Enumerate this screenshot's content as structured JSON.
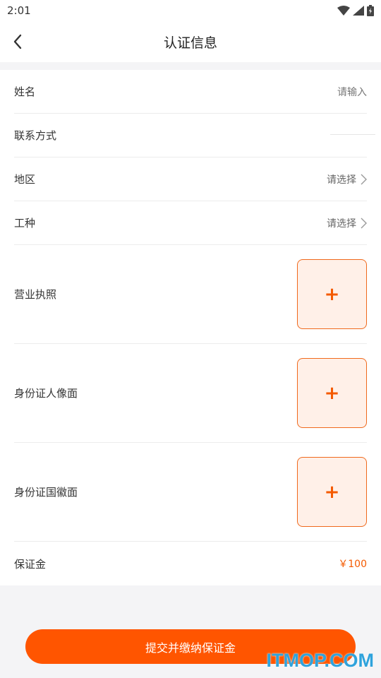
{
  "status_bar": {
    "time": "2:01"
  },
  "nav": {
    "title": "认证信息"
  },
  "form": {
    "name": {
      "label": "姓名",
      "placeholder": "请输入"
    },
    "contact": {
      "label": "联系方式"
    },
    "region": {
      "label": "地区",
      "value": "请选择"
    },
    "trade": {
      "label": "工种",
      "value": "请选择"
    },
    "license": {
      "label": "营业执照",
      "plus": "+"
    },
    "id_front": {
      "label": "身份证人像面",
      "plus": "+"
    },
    "id_back": {
      "label": "身份证国徽面",
      "plus": "+"
    },
    "deposit": {
      "label": "保证金",
      "value": "￥100"
    }
  },
  "submit": {
    "label": "提交并缴纳保证金"
  },
  "watermark": {
    "text": "ITMOP.COM"
  },
  "colors": {
    "accent": "#ff5500",
    "upload_bg": "#fff0e8",
    "watermark": "#2fa3dc"
  },
  "icons": [
    "wifi-icon",
    "signal-icon",
    "battery-icon",
    "back-arrow-icon",
    "chevron-right-icon"
  ]
}
